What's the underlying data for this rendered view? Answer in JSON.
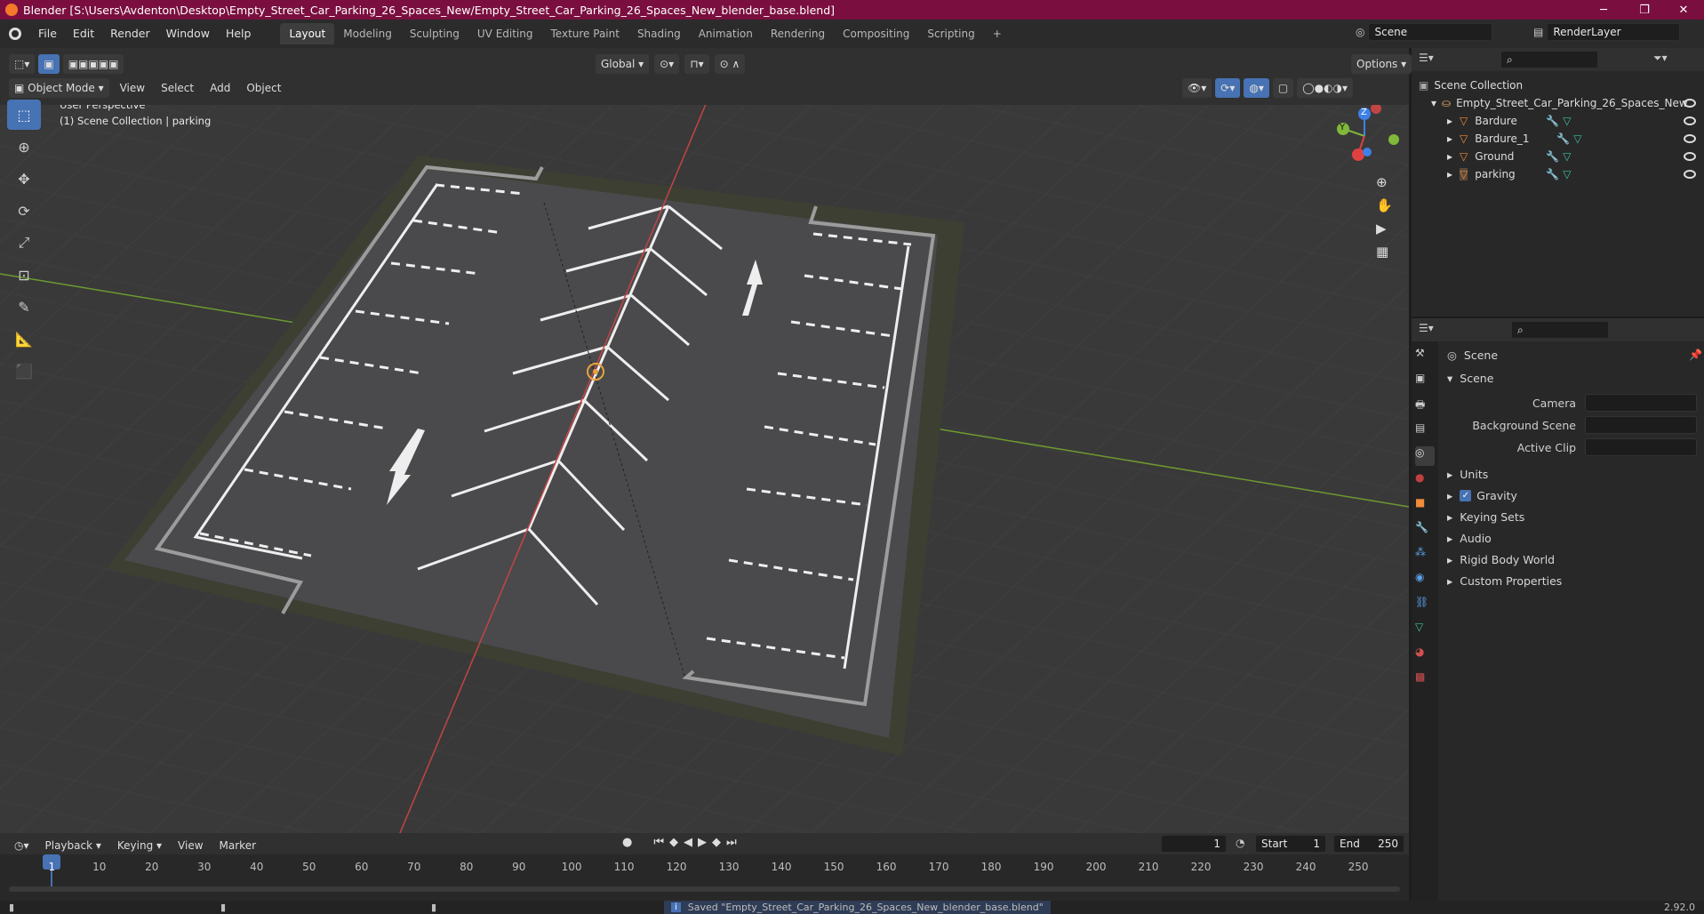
{
  "window": {
    "title": "Blender [S:\\Users\\Avdenton\\Desktop\\Empty_Street_Car_Parking_26_Spaces_New/Empty_Street_Car_Parking_26_Spaces_New_blender_base.blend]",
    "minimize": "─",
    "maximize": "❐",
    "close": "✕"
  },
  "menubar": {
    "items": [
      "File",
      "Edit",
      "Render",
      "Window",
      "Help"
    ],
    "workspaces": [
      "Layout",
      "Modeling",
      "Sculpting",
      "UV Editing",
      "Texture Paint",
      "Shading",
      "Animation",
      "Rendering",
      "Compositing",
      "Scripting"
    ],
    "add_tab": "+",
    "scene": "Scene",
    "view_layer": "RenderLayer"
  },
  "viewport_header": {
    "mode": "Object Mode",
    "menus": [
      "View",
      "Select",
      "Add",
      "Object"
    ],
    "orientation": "Global",
    "options": "Options"
  },
  "viewport": {
    "perspective": "User Perspective",
    "collection_info": "(1) Scene Collection | parking",
    "gizmo": {
      "z": "Z",
      "y": "Y",
      "x": "X"
    }
  },
  "outliner": {
    "root": "Scene Collection",
    "collection": "Empty_Street_Car_Parking_26_Spaces_New",
    "items": [
      "Bardure",
      "Bardure_1",
      "Ground",
      "parking"
    ]
  },
  "properties": {
    "title": "Scene",
    "panel": "Scene",
    "fields": [
      {
        "label": "Camera"
      },
      {
        "label": "Background Scene"
      },
      {
        "label": "Active Clip"
      }
    ],
    "sections": [
      "Units",
      "Gravity",
      "Keying Sets",
      "Audio",
      "Rigid Body World",
      "Custom Properties"
    ],
    "gravity_checked": true
  },
  "timeline": {
    "menus": [
      "Playback",
      "Keying",
      "View",
      "Marker"
    ],
    "current_frame": "1",
    "start_label": "Start",
    "start": "1",
    "end_label": "End",
    "end": "250",
    "ticks": [
      "1",
      "10",
      "20",
      "30",
      "40",
      "50",
      "60",
      "70",
      "80",
      "90",
      "100",
      "110",
      "120",
      "130",
      "140",
      "150",
      "160",
      "170",
      "180",
      "190",
      "200",
      "210",
      "220",
      "230",
      "240",
      "250"
    ]
  },
  "statusbar": {
    "message": "Saved \"Empty_Street_Car_Parking_26_Spaces_New_blender_base.blend\"",
    "version": "2.92.0"
  },
  "colors": {
    "title_bg": "#7a0f3f",
    "accent": "#4772b3",
    "x_axis": "#e04040",
    "y_axis": "#7fb83a",
    "z_axis": "#3d80e6"
  }
}
